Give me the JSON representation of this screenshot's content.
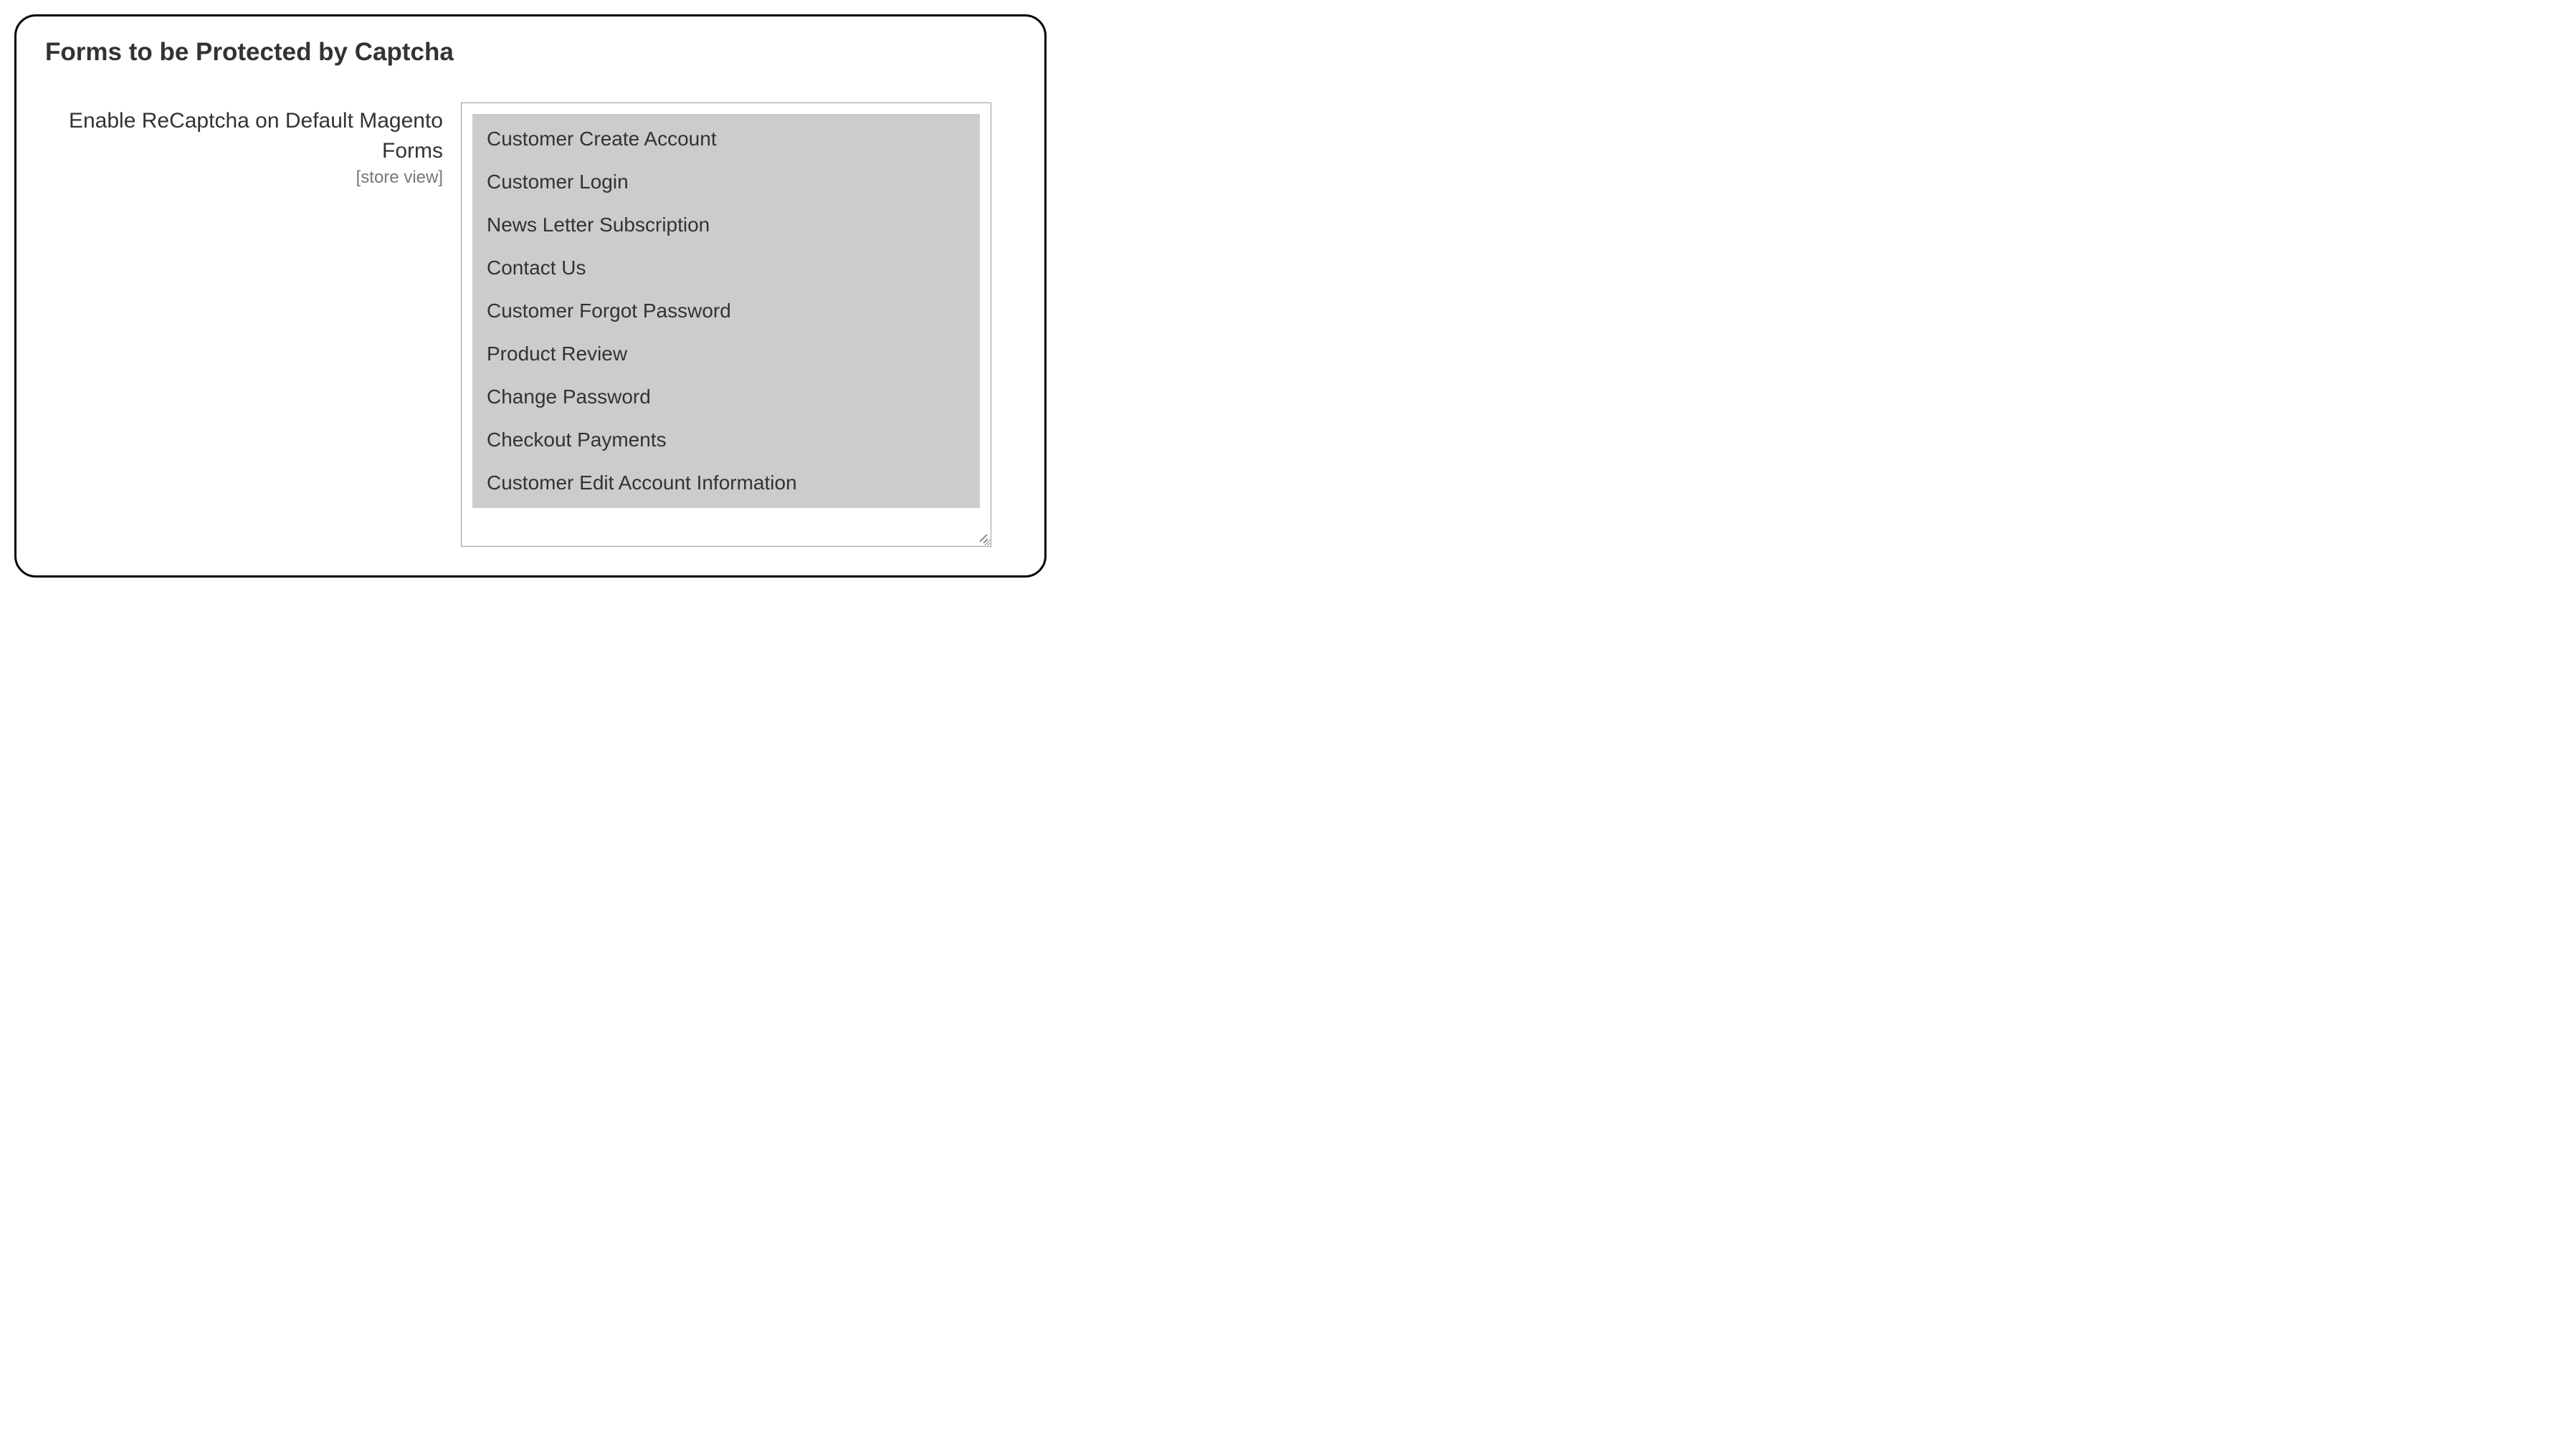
{
  "section": {
    "title": "Forms to be Protected by Captcha"
  },
  "field": {
    "label": "Enable ReCaptcha on Default Magento Forms",
    "scope": "[store view]",
    "options": [
      "Customer Create Account",
      "Customer Login",
      "News Letter Subscription",
      "Contact Us",
      "Customer Forgot Password",
      "Product Review",
      "Change Password",
      "Checkout Payments",
      "Customer Edit Account Information"
    ]
  }
}
